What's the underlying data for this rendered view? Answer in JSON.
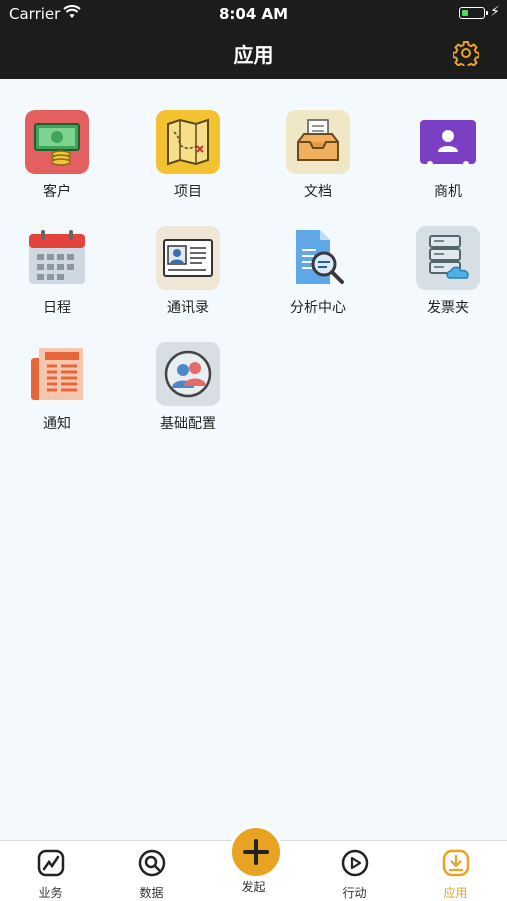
{
  "status_bar": {
    "carrier": "Carrier",
    "time": "8:04 AM"
  },
  "nav": {
    "title": "应用",
    "settings_icon": "gear-icon",
    "accent": "#e7a321"
  },
  "apps": [
    {
      "label": "客户",
      "icon": "money-icon"
    },
    {
      "label": "项目",
      "icon": "map-icon"
    },
    {
      "label": "文档",
      "icon": "inbox-tray-icon"
    },
    {
      "label": "商机",
      "icon": "id-card-icon"
    },
    {
      "label": "日程",
      "icon": "calendar-icon"
    },
    {
      "label": "通讯录",
      "icon": "contact-card-icon"
    },
    {
      "label": "分析中心",
      "icon": "document-search-icon"
    },
    {
      "label": "发票夹",
      "icon": "cloud-server-icon"
    },
    {
      "label": "通知",
      "icon": "newspaper-icon"
    },
    {
      "label": "基础配置",
      "icon": "users-config-icon"
    }
  ],
  "tabs": [
    {
      "label": "业务",
      "icon": "chart-icon"
    },
    {
      "label": "数据",
      "icon": "search-icon"
    },
    {
      "label": "发起",
      "icon": "plus-icon"
    },
    {
      "label": "行动",
      "icon": "play-icon"
    },
    {
      "label": "应用",
      "icon": "download-icon",
      "active": true
    }
  ]
}
